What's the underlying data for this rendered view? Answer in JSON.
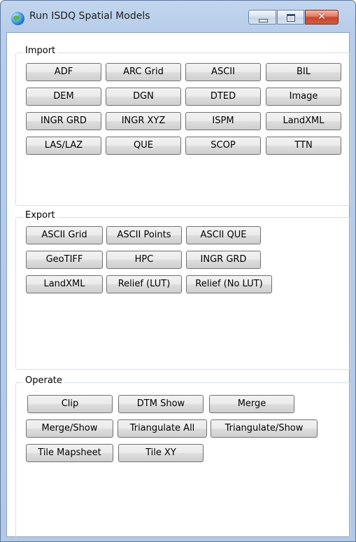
{
  "window": {
    "title": "Run ISDQ Spatial Models",
    "controls": {
      "minimize": "minimize",
      "maximize": "maximize",
      "close": "✕"
    }
  },
  "import": {
    "label": "Import",
    "buttons": [
      "ADF",
      "ARC Grid",
      "ASCII",
      "BIL",
      "DEM",
      "DGN",
      "DTED",
      "Image",
      "INGR GRD",
      "INGR XYZ",
      "ISPM",
      "LandXML",
      "LAS/LAZ",
      "QUE",
      "SCOP",
      "TTN"
    ]
  },
  "export": {
    "label": "Export",
    "buttons": [
      "ASCII Grid",
      "ASCII Points",
      "ASCII QUE",
      "GeoTIFF",
      "HPC",
      "INGR GRD",
      "LandXML",
      "Relief (LUT)",
      "Relief (No LUT)"
    ]
  },
  "operate": {
    "label": "Operate",
    "buttons": [
      "Clip",
      "DTM Show",
      "Merge",
      "Merge/Show",
      "Triangulate All",
      "Triangulate/Show",
      "Tile Mapsheet",
      "Tile XY"
    ]
  }
}
